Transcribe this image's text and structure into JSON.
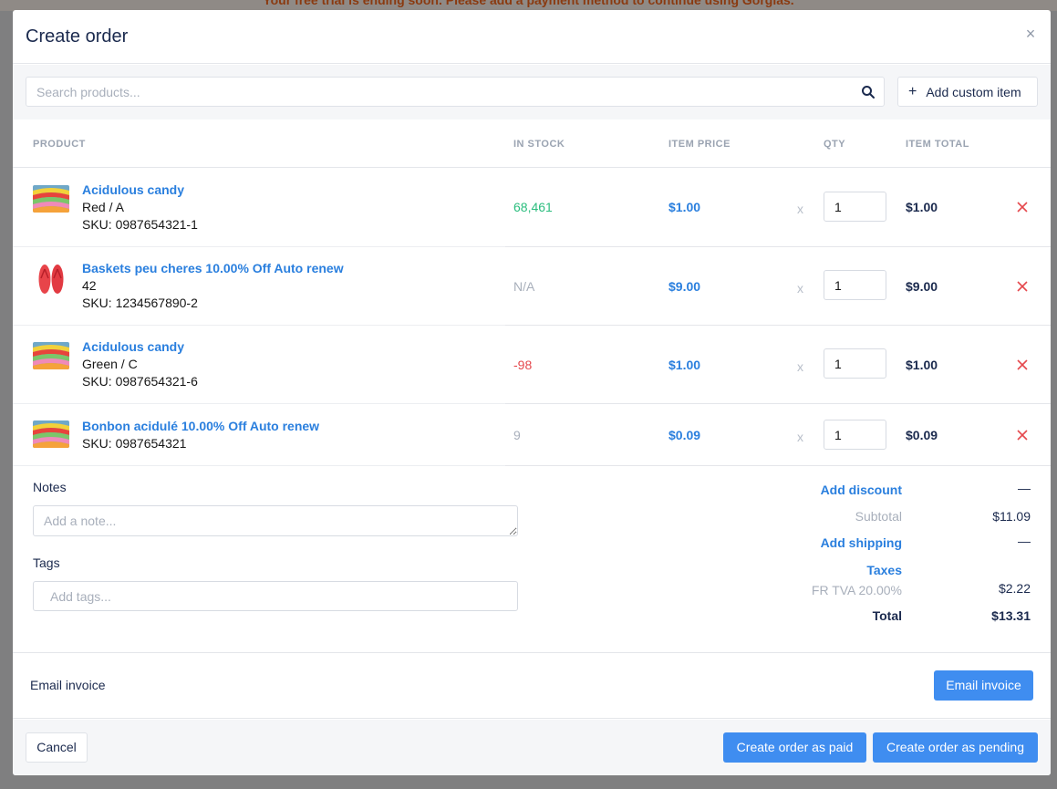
{
  "banner": {
    "text": "Your free trial is ending soon. Please add a payment method to continue using Gorgias."
  },
  "modal": {
    "title": "Create order",
    "close_symbol": "×"
  },
  "search": {
    "placeholder": "Search products..."
  },
  "toolbar": {
    "add_custom_item_label": "Add custom item",
    "add_icon": "plus-icon"
  },
  "table": {
    "headers": {
      "product": "PRODUCT",
      "in_stock": "IN STOCK",
      "item_price": "ITEM PRICE",
      "qty": "QTY",
      "item_total": "ITEM TOTAL"
    },
    "rows": [
      {
        "name": "Acidulous candy",
        "variant": "Red / A",
        "sku": "SKU: 0987654321-1",
        "stock": "68,461",
        "price": "$1.00",
        "times": "x",
        "qty": "1",
        "total": "$1.00",
        "image": "candy-icon"
      },
      {
        "name": "Baskets peu cheres 10.00% Off Auto renew",
        "variant": "42",
        "sku": "SKU: 1234567890-2",
        "stock": "N/A",
        "price": "$9.00",
        "times": "x",
        "qty": "1",
        "total": "$9.00",
        "image": "flip-flops-icon"
      },
      {
        "name": "Acidulous candy",
        "variant": "Green / C",
        "sku": "SKU: 0987654321-6",
        "stock": "-98",
        "price": "$1.00",
        "times": "x",
        "qty": "1",
        "total": "$1.00",
        "image": "candy-icon"
      },
      {
        "name": "Bonbon acidulé 10.00% Off Auto renew",
        "sku": "SKU: 0987654321",
        "stock": "9",
        "price": "$0.09",
        "times": "x",
        "qty": "1",
        "total": "$0.09",
        "image": "candy-icon"
      }
    ]
  },
  "notes": {
    "label": "Notes",
    "placeholder": "Add a note..."
  },
  "tags": {
    "label": "Tags",
    "placeholder": "Add tags..."
  },
  "summary": {
    "add_discount": "Add discount",
    "discount_value": "—",
    "subtotal_label": "Subtotal",
    "subtotal_value": "$11.09",
    "add_shipping": "Add shipping",
    "shipping_value": "—",
    "taxes_label": "Taxes",
    "tax_line_label": "FR TVA 20.00%",
    "tax_line_value": "$2.22",
    "total_label": "Total",
    "total_value": "$13.31"
  },
  "email_invoice": {
    "label": "Email invoice",
    "button": "Email invoice"
  },
  "footer": {
    "cancel": "Cancel",
    "create_paid": "Create order as paid",
    "create_pending": "Create order as pending"
  },
  "colors": {
    "accent": "#3f8df0",
    "link": "#2a7fde",
    "stock_positive": "#2bbd7e",
    "stock_negative": "#e5484d",
    "muted": "#a8afbb"
  }
}
